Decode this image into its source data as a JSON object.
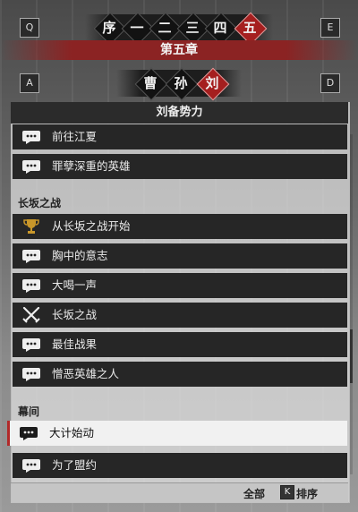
{
  "keys": {
    "q": "Q",
    "e": "E",
    "a": "A",
    "d": "D"
  },
  "chapter_tabs": [
    "序",
    "一",
    "二",
    "三",
    "四",
    "五"
  ],
  "active_chapter_index": 5,
  "chapter_title": "第五章",
  "factions": [
    "曹",
    "孙",
    "刘"
  ],
  "active_faction_index": 2,
  "panel_title": "刘备势力",
  "section_headers": {
    "changban": "长坂之战",
    "intermission": "幕间"
  },
  "items": [
    {
      "label": "前往江夏",
      "icon": "chat-bubble-icon"
    },
    {
      "label": "罪孽深重的英雄",
      "icon": "chat-bubble-icon"
    },
    {
      "label": "从长坂之战开始",
      "icon": "trophy-icon"
    },
    {
      "label": "胸中的意志",
      "icon": "chat-bubble-icon"
    },
    {
      "label": "大喝一声",
      "icon": "chat-bubble-icon"
    },
    {
      "label": "长坂之战",
      "icon": "crossed-swords-icon"
    },
    {
      "label": "最佳战果",
      "icon": "chat-bubble-icon"
    },
    {
      "label": "憎恶英雄之人",
      "icon": "chat-bubble-icon"
    },
    {
      "label": "大计始动",
      "icon": "chat-bubble-icon"
    },
    {
      "label": "为了盟约",
      "icon": "chat-bubble-icon"
    }
  ],
  "selected_item_index": 8,
  "footer": {
    "all_label": "全部",
    "sort_key": "K",
    "sort_label": "排序"
  },
  "colors": {
    "accent_red": "#a51f1f",
    "row_dark": "#262626",
    "selected_row": "#f1f1f1"
  }
}
